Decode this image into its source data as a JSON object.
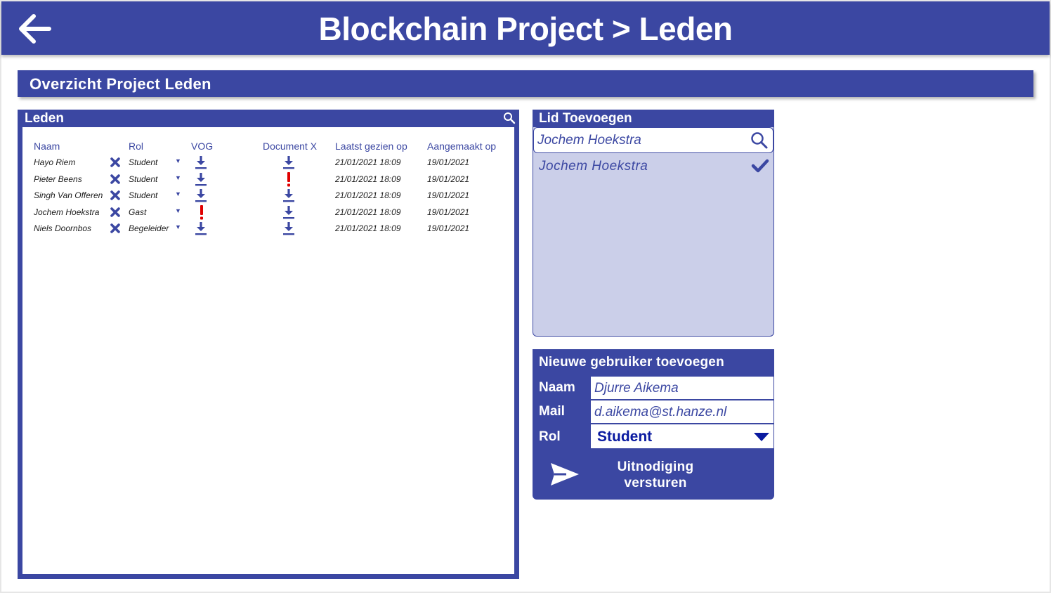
{
  "header": {
    "title": "Blockchain Project > Leden",
    "back_icon": "arrow-left-icon"
  },
  "section": {
    "title": "Overzicht Project Leden"
  },
  "leden": {
    "title": "Leden",
    "columns": [
      "Naam",
      "Rol",
      "VOG",
      "Document X",
      "Laatst gezien op",
      "Aangemaakt op"
    ],
    "rows": [
      {
        "naam": "Hayo Riem",
        "rol": "Student",
        "vog": "download",
        "doc": "download",
        "laatst": "21/01/2021 18:09",
        "aangemaakt": "19/01/2021"
      },
      {
        "naam": "Pieter Beens",
        "rol": "Student",
        "vog": "download",
        "doc": "missing",
        "laatst": "21/01/2021 18:09",
        "aangemaakt": "19/01/2021"
      },
      {
        "naam": "Singh Van Offeren",
        "rol": "Student",
        "vog": "download",
        "doc": "download",
        "laatst": "21/01/2021 18:09",
        "aangemaakt": "19/01/2021"
      },
      {
        "naam": "Jochem Hoekstra",
        "rol": "Gast",
        "vog": "missing",
        "doc": "download",
        "laatst": "21/01/2021 18:09",
        "aangemaakt": "19/01/2021"
      },
      {
        "naam": "Niels Doornbos",
        "rol": "Begeleider",
        "vog": "download",
        "doc": "download",
        "laatst": "21/01/2021 18:09",
        "aangemaakt": "19/01/2021"
      }
    ]
  },
  "lid_toevoegen": {
    "title": "Lid Toevoegen",
    "search_value": "Jochem Hoekstra",
    "results": [
      "Jochem Hoekstra"
    ]
  },
  "nieuwe_gebruiker": {
    "title": "Nieuwe gebruiker toevoegen",
    "naam_label": "Naam",
    "naam_value": "Djurre Aikema",
    "mail_label": "Mail",
    "mail_value": "d.aikema@st.hanze.nl",
    "rol_label": "Rol",
    "rol_value": "Student",
    "send_label": "Uitnodiging versturen"
  },
  "colors": {
    "primary": "#3b47a2",
    "light": "#cbcfe9",
    "warning": "#e00000",
    "selected_text": "#0a1aa0"
  }
}
